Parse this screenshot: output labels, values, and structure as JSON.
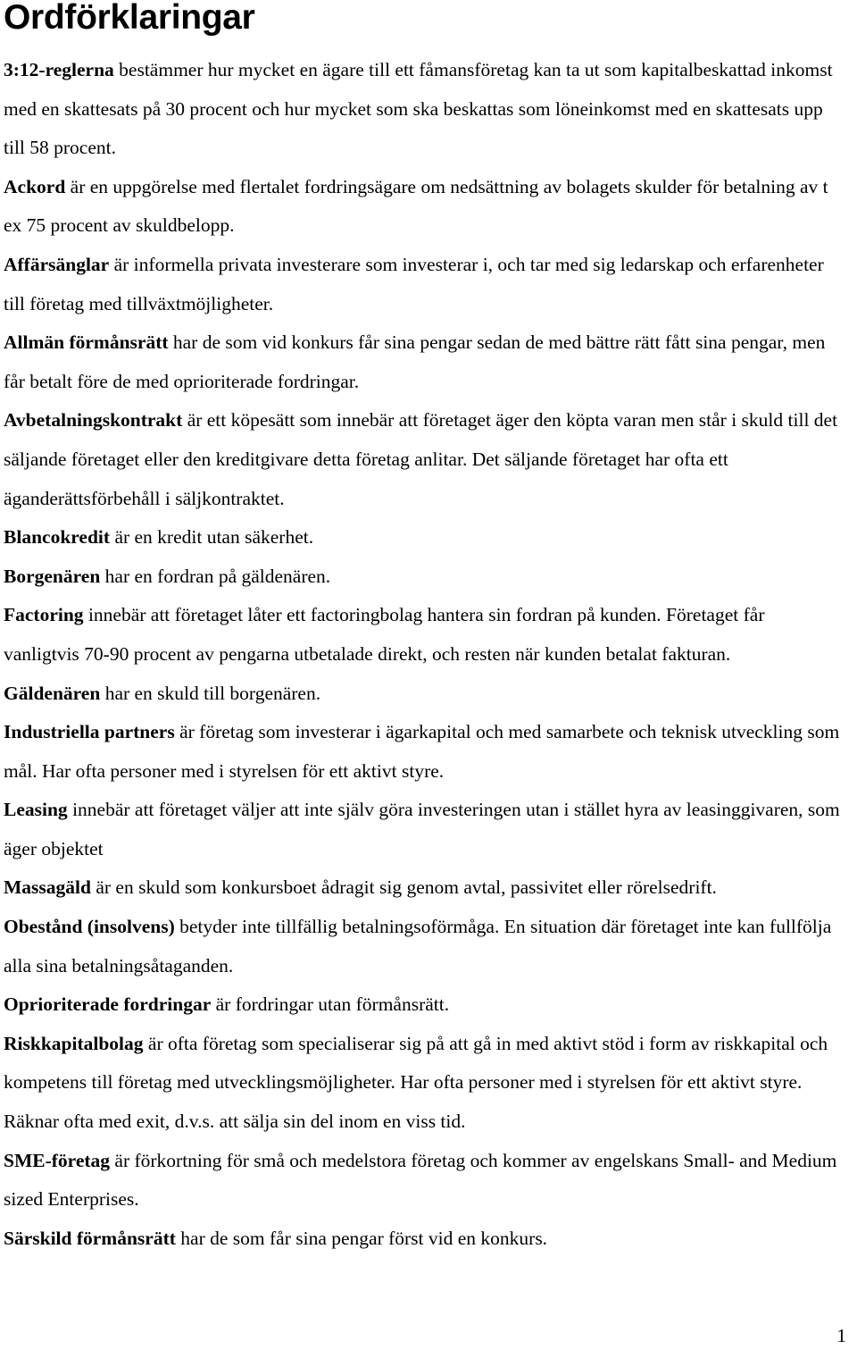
{
  "document": {
    "title": "Ordförklaringar",
    "page_number": "1",
    "entries": [
      {
        "term": "3:12-reglerna",
        "definition": " bestämmer hur mycket en ägare till ett fåmansföretag kan ta ut som kapitalbeskattad inkomst med en skattesats på 30 procent och hur mycket som ska beskattas som löneinkomst med en skattesats upp till 58 procent."
      },
      {
        "term": "Ackord",
        "definition": " är en uppgörelse med flertalet fordringsägare om nedsättning av bolagets skulder för betalning av t ex 75 procent av skuldbelopp."
      },
      {
        "term": "Affärsänglar",
        "definition": " är informella privata investerare som investerar i, och tar med sig ledarskap och erfarenheter till företag med tillväxtmöjligheter."
      },
      {
        "term": "Allmän förmånsrätt",
        "definition": " har de som vid konkurs får sina pengar sedan de med bättre rätt fått sina pengar, men får betalt före de med oprioriterade fordringar."
      },
      {
        "term": "Avbetalningskontrakt",
        "definition": " är ett köpesätt som innebär att företaget äger den köpta varan men står i skuld till det säljande företaget eller den kreditgivare detta företag anlitar. Det säljande företaget har ofta ett äganderättsförbehåll i säljkontraktet."
      },
      {
        "term": "Blancokredit",
        "definition": " är en kredit utan säkerhet."
      },
      {
        "term": "Borgenären",
        "definition": " har en fordran på gäldenären."
      },
      {
        "term": "Factoring",
        "definition": " innebär att företaget låter ett factoringbolag hantera sin fordran på kunden. Företaget får vanligtvis 70-90 procent av pengarna utbetalade direkt, och resten när kunden betalat fakturan."
      },
      {
        "term": "Gäldenären",
        "definition": " har en skuld till borgenären."
      },
      {
        "term": "Industriella partners",
        "definition": " är företag som investerar i ägarkapital och med samarbete och teknisk utveckling som mål. Har ofta personer med i styrelsen för ett aktivt styre."
      },
      {
        "term": "Leasing",
        "definition": " innebär att företaget väljer att inte själv göra investeringen utan i stället hyra av leasinggivaren, som äger objektet"
      },
      {
        "term": "Massagäld",
        "definition": " är en skuld som konkursboet ådragit sig genom avtal, passivitet eller rörelsedrift."
      },
      {
        "term": "Obestånd (insolvens)",
        "definition": " betyder inte tillfällig betalningsoförmåga. En situation där företaget inte kan fullfölja alla sina betalningsåtaganden."
      },
      {
        "term": "Oprioriterade fordringar",
        "definition": " är fordringar utan förmånsrätt."
      },
      {
        "term": "Riskkapitalbolag",
        "definition": " är ofta företag som specialiserar sig på att gå in med aktivt stöd i form av riskkapital och kompetens till företag med utvecklingsmöjligheter. Har ofta personer med i styrelsen för ett aktivt styre. Räknar ofta med exit, d.v.s. att sälja sin del inom en viss tid."
      },
      {
        "term": "SME-företag",
        "definition": " är förkortning för små och medelstora företag och kommer av engelskans Small- and Medium sized Enterprises."
      },
      {
        "term": "Särskild förmånsrätt",
        "definition": " har de som får sina pengar först vid en konkurs."
      }
    ]
  }
}
